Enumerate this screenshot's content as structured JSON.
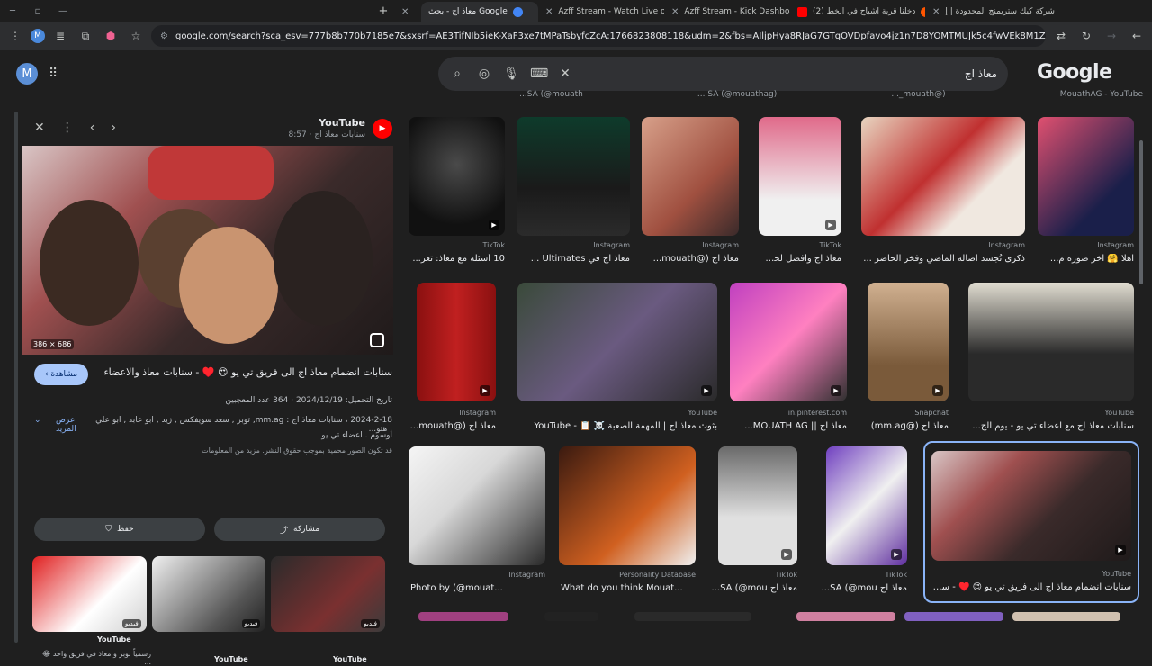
{
  "tabs": [
    {
      "label": "",
      "favicon": "#ff0000"
    },
    {
      "label": "معاذ اج - بحث Google",
      "favicon": "#4285f4",
      "active": true
    },
    {
      "label": "Azff Stream - Watch Live on Ki",
      "favicon": "#53fc18"
    },
    {
      "label": "Azff Stream - Kick Dashboard",
      "favicon": "#53fc18"
    },
    {
      "label": "(2) دخلنا قرية اشباح في الخط",
      "favicon": "#ff0000"
    },
    {
      "label": "شركة كيك ستريمنج المحدودة | إ",
      "favicon": "#4a89dc"
    }
  ],
  "address": {
    "url": "google.com/search?sca_esv=777b8b770b7185e7&sxsrf=AE3TifNIb5ieK-XaF3xe7tMPaTsbyfcZcA:1766823808118&udm=2&fbs=AIljpHya8RJaG7GTqOVDpfavo4jz1n7D8YOMTMUJk5c4fwVEk8M1ZVUkgny-WLGRmY2nFYdCXvu6kpyfFXgZY18..."
  },
  "header": {
    "avatar": "M",
    "logo": "Google",
    "query": "معاذ اج"
  },
  "panel": {
    "source": "YouTube",
    "subtitle": "سنابات معاذ اج · 8:57",
    "img_dim": "386 × 686",
    "title": "سنابات انضمام معاذ اج الى فريق تي يو 😍 ♥️ - سنابات معاذ والاعضاء",
    "visit": "مشاهدة",
    "meta1": "تاريخ التحميل: 2024/12/19 · 364 عدد المعجبين",
    "meta2": "2024-2-18 ، سنابات معاذ اج : mm.ag, توبز , سعد سويفكس , زيد , ابو عابد , ابو علي , هتو...",
    "meta3": "اوسوم . اعضاء تي يو",
    "meta4": "قد تكون الصور محمية بموجب حقوق النشر. مزيد من المعلومات",
    "more": "عرض المزيد",
    "save": "حفظ",
    "share": "مشاركة",
    "thumbs": [
      {
        "tag": "فيديو",
        "src": "YouTube",
        "cap": "رسمياً توبز و معاذ في فريق واحد 😂 ..."
      },
      {
        "tag": "فيديو",
        "src": "YouTube",
        "cap": ""
      },
      {
        "tag": "فيديو",
        "src": "YouTube",
        "cap": ""
      }
    ]
  },
  "grid": {
    "top_caps": [
      "MouathAG - YouTube",
      "(@mouath_...",
      "SA (@mouathag) ...",
      "SA (@mouath...",
      ""
    ],
    "row1": [
      {
        "src": "TikTok",
        "cap": "10 أسئلة مع معاذ: تعر..."
      },
      {
        "src": "Instagram",
        "cap": "معاذ اج في Ultimates ..."
      },
      {
        "src": "Instagram",
        "cap": "معاذ اج (@mouath..."
      },
      {
        "src": "TikTok",
        "cap": "معاذ اج وأفضل لحظات..."
      },
      {
        "src": "Instagram",
        "cap": "ذكرى تُجسد أصالة الماضي وفخر الحاضر ..."
      },
      {
        "src": "Instagram",
        "cap": "اهلا 🤗 اخر صوره م..."
      }
    ],
    "row2": [
      {
        "src": "Instagram",
        "cap": "معاذ اج (@mouath..."
      },
      {
        "src": "YouTube",
        "cap": "بثوث معاذ اج | المهمة الصعبة ☠️ 📋 - YouTube"
      },
      {
        "src": "in.pinterest.com",
        "cap": "معاذ اج || MOUATH AG..."
      },
      {
        "src": "Snapchat",
        "cap": "معاذ اج (@mm.ag)"
      },
      {
        "src": "YouTube",
        "cap": "سنابات معاذ اج مع اعضاء تي يو - يوم الج..."
      }
    ],
    "row3": [
      {
        "src": "Instagram",
        "cap": "Photo by (@mouat..."
      },
      {
        "src": "Personality Database",
        "cap": "What do you think Mouat..."
      },
      {
        "src": "TikTok",
        "cap": "معاذ اج SA (@mou..."
      },
      {
        "src": "TikTok",
        "cap": "معاذ اج SA (@mou..."
      },
      {
        "src": "YouTube",
        "cap": "سنابات انضمام معاذ اج الى فريق تي يو 😍 ♥️ - سناب..."
      }
    ]
  }
}
